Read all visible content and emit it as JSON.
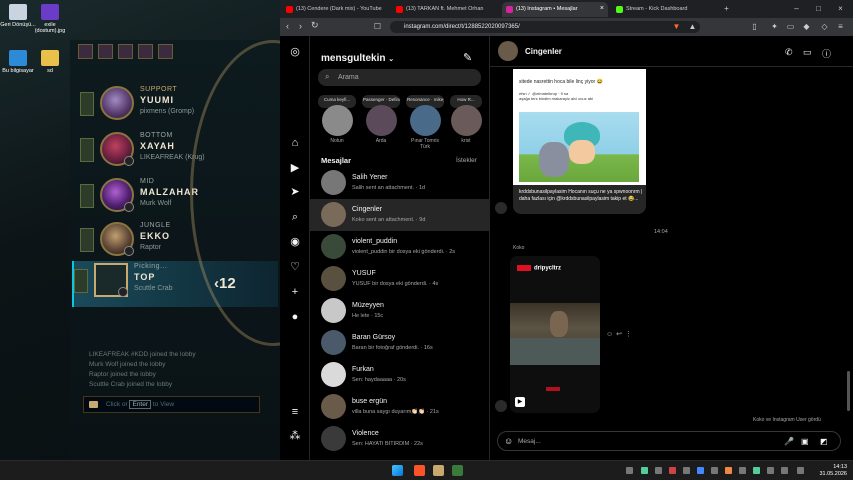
{
  "desktop": {
    "icons": [
      {
        "label": "Geri Dönüşü...",
        "color": "#c9d4e0"
      },
      {
        "label": "exile (dostum).jpg",
        "color": "#6a3cc8"
      },
      {
        "label": "Bu bilgisayar",
        "color": "#2d8ad6"
      },
      {
        "label": "sd",
        "color": "#e8c04a"
      }
    ]
  },
  "lol": {
    "players": [
      {
        "position": "SUPPORT",
        "champion": "YUUMI",
        "name": "pixmens (Gromp)"
      },
      {
        "position": "BOTTOM",
        "champion": "XAYAH",
        "name": "LIKEAFREAK (Krug)"
      },
      {
        "position": "MID",
        "champion": "MALZAHAR",
        "name": "Murk Wolf"
      },
      {
        "position": "JUNGLE",
        "champion": "EKKO",
        "name": "Raptor"
      },
      {
        "position": "Picking...",
        "champion": "TOP",
        "name": "Scuttle Crab"
      }
    ],
    "timer": "12",
    "chat": [
      "LIKEAFREAK #KDD joined the lobby",
      "Murk Wolf joined the lobby",
      "Raptor joined the lobby",
      "Scuttle Crab joined the lobby"
    ],
    "chat_input": {
      "before": "Click or",
      "key": "Enter",
      "after": "to View"
    }
  },
  "browser": {
    "tabs": [
      {
        "title": "(13) Cendere (Dark mix) - YouTube",
        "color": "#ff0000"
      },
      {
        "title": "(13) TARKAN ft. Mehmet Orhan",
        "color": "#ff0000"
      },
      {
        "title": "(13) Instagram • Mesajlar",
        "color": "#d6249f"
      },
      {
        "title": "Stream - Kick Dashboard",
        "color": "#53fc18"
      }
    ],
    "url": "instagram.com/direct/t/1288522020097365/"
  },
  "instagram": {
    "username": "mensgultekin",
    "search_placeholder": "Arama",
    "notes": [
      {
        "bubble": "Cuma keyfi...",
        "name": "Notun"
      },
      {
        "bubble": "Passenger · Definition",
        "name": "Arda"
      },
      {
        "bubble": "Resonance · mikeyyymind",
        "name": "Pınar Tomris Türk"
      },
      {
        "bubble": "How R...",
        "name": "krist"
      }
    ],
    "messages_header": "Mesajlar",
    "requests": "İstekler",
    "conversations": [
      {
        "name": "Salih Yener",
        "preview": "Salih sent an attachment. · 1d"
      },
      {
        "name": "Cingenler",
        "preview": "Koko sent an attachment. · 9d"
      },
      {
        "name": "violent_puddin",
        "preview": "violent_puddin bir dosya eki gönderdi. · 2s"
      },
      {
        "name": "YUSUF",
        "preview": "YUSUF bir dosya eki gönderdi. · 4s"
      },
      {
        "name": "Müzeyyen",
        "preview": "He lete · 15c"
      },
      {
        "name": "Baran Gürsoy",
        "preview": "Baran bir fotoğraf gönderdi. · 16s"
      },
      {
        "name": "Furkan",
        "preview": "Sen: haydaaaaa · 20s"
      },
      {
        "name": "buse ergün",
        "preview": "villa buna saygı duyarım👏🏻👏🏻 · 21s"
      },
      {
        "name": "Violence",
        "preview": "Sen: HAYATI BITIRDIM · 22s"
      }
    ],
    "thread": {
      "title": "Cingenler",
      "card_text": "sitede nasrettin hoca bile linç yiyor 😂",
      "card_inner": "efsn ✓ @eimatelbrup · 9 sa\naşağa ters bindim makarayiz alvi ocuz abi",
      "card_caption": "krddsbunasilpaylasim Hocanın suçu ne ya spwnoonrm | daha fazlası için @krddsbunasilpaylasim takip et 😂...",
      "timestamp": "14:04",
      "sender": "Koko",
      "reel_account": "dripycltrz",
      "seen_text": "Koko ve Instagram User gördü",
      "composer_placeholder": "Mesaj..."
    }
  },
  "taskbar": {
    "time": "14:13",
    "date": "31.05.2026"
  }
}
